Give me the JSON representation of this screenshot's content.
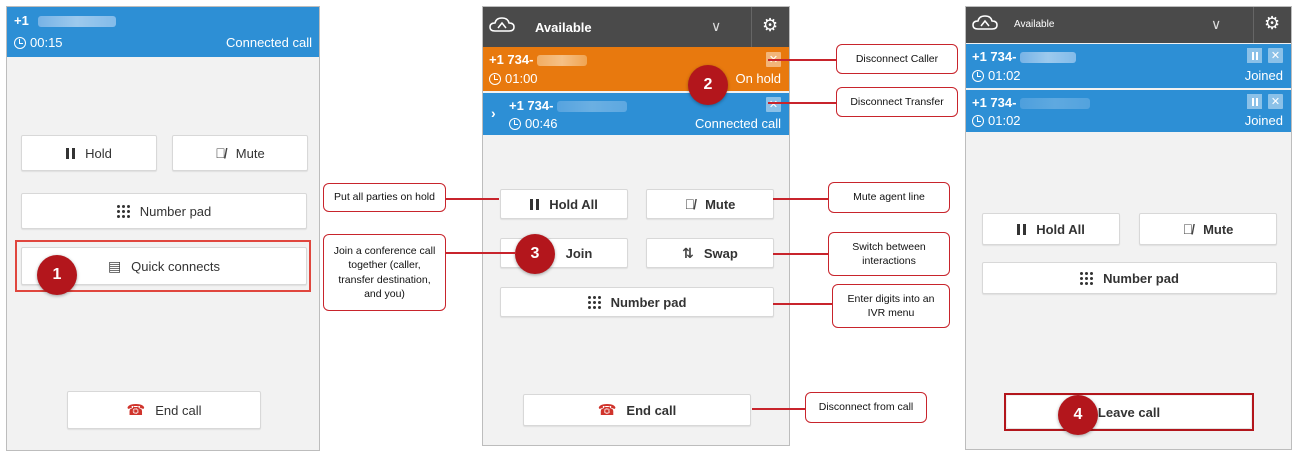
{
  "panel1": {
    "phone_prefix": "+1",
    "timer": "00:15",
    "status": "Connected call",
    "buttons": {
      "hold": "Hold",
      "mute": "Mute",
      "number_pad": "Number pad",
      "quick_connects": "Quick connects",
      "end_call": "End call"
    },
    "badge": "1"
  },
  "panel2": {
    "agent_status": "Available",
    "caller": {
      "phone_prefix": "+1 734-",
      "timer": "01:00",
      "status": "On hold"
    },
    "transfer": {
      "phone_prefix": "+1 734-",
      "timer": "00:46",
      "status": "Connected call"
    },
    "buttons": {
      "hold_all": "Hold All",
      "mute": "Mute",
      "join": "Join",
      "swap": "Swap",
      "number_pad": "Number pad",
      "end_call": "End call"
    },
    "badges": {
      "two": "2",
      "three": "3"
    }
  },
  "panel3": {
    "agent_status": "Available",
    "party1": {
      "phone_prefix": "+1 734-",
      "timer": "01:02",
      "status": "Joined"
    },
    "party2": {
      "phone_prefix": "+1 734-",
      "timer": "01:02",
      "status": "Joined"
    },
    "buttons": {
      "hold_all": "Hold All",
      "mute": "Mute",
      "number_pad": "Number pad",
      "leave_call": "Leave call"
    },
    "badge": "4"
  },
  "callouts": {
    "put_on_hold": "Put all parties on hold",
    "join_conference": "Join a conference call together (caller, transfer destination, and you)",
    "disconnect_caller": "Disconnect Caller",
    "disconnect_transfer": "Disconnect Transfer",
    "mute_agent": "Mute agent line",
    "switch_interactions": "Switch between interactions",
    "enter_digits": "Enter digits into an IVR menu",
    "disconnect_call": "Disconnect from call"
  },
  "colors": {
    "accent_blue": "#2d8fd5",
    "hold_orange": "#e8790e",
    "callout_red": "#c8242c",
    "badge_red": "#b3161c",
    "end_red": "#d0342c"
  }
}
